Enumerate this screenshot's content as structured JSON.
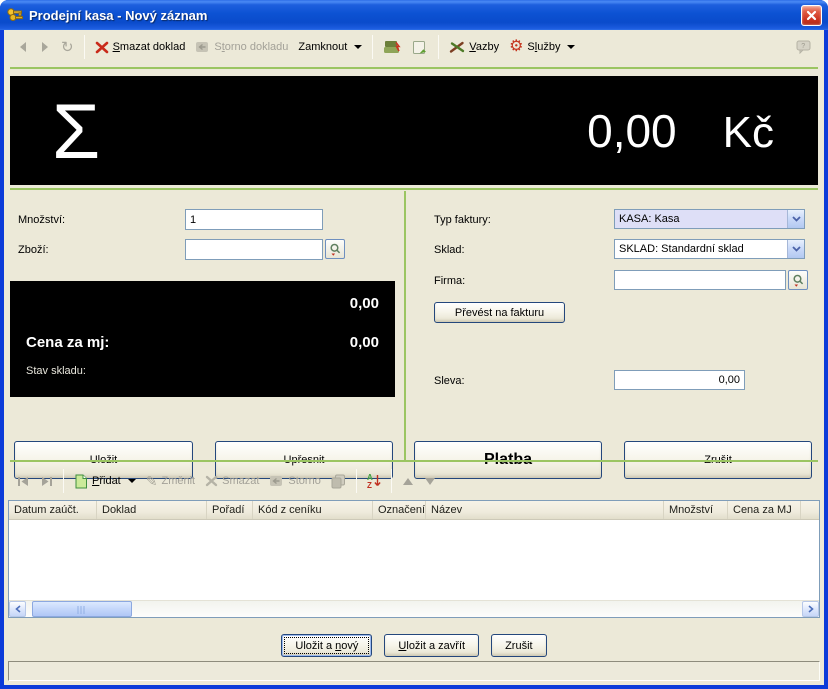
{
  "window": {
    "title": "Prodejní kasa - Nový záznam"
  },
  "toolbar": {
    "smazat_doklad": {
      "pre": "",
      "key": "S",
      "post": "mazat doklad"
    },
    "storno_dokladu": {
      "pre": "S",
      "key": "t",
      "post": "orno dokladu"
    },
    "zamknout": "Zamknout",
    "vazby": {
      "pre": "",
      "key": "V",
      "post": "azby"
    },
    "sluzby": {
      "pre": "S",
      "key": "l",
      "post": "užby"
    }
  },
  "sum_display": {
    "sigma": "Σ",
    "amount": "0,00",
    "currency": "Kč"
  },
  "item_form": {
    "mnozstvi_label": "Množství:",
    "mnozstvi_value": "1",
    "zbozi_label": "Zboží:",
    "zbozi_value": "",
    "info_total": "0,00",
    "cena_label": "Cena za mj:",
    "cena_value": "0,00",
    "stav_label": "Stav skladu:",
    "ulozit_button": "Uložit",
    "upresnit_button": "Upřesnit"
  },
  "doc_form": {
    "typ_faktury_label": "Typ faktury:",
    "typ_faktury_value": "KASA: Kasa",
    "sklad_label": "Sklad:",
    "sklad_value": "SKLAD: Standardní sklad",
    "firma_label": "Firma:",
    "firma_value": "",
    "prevest_button": "Převést na fakturu",
    "sleva_label": "Sleva:",
    "sleva_value": "0,00",
    "platba_button": "Platba",
    "zrusit_button": "Zrušit"
  },
  "grid_toolbar": {
    "pridat": {
      "pre": "",
      "key": "P",
      "post": "řidat"
    },
    "zmenit": "Změnit",
    "smazat": "Smazat",
    "storno": "Storno"
  },
  "table": {
    "columns": [
      "Datum zaúčt.",
      "Doklad",
      "Pořadí",
      "Kód z ceníku",
      "Označení",
      "Název",
      "Množství",
      "Cena za MJ"
    ],
    "rows": []
  },
  "footer": {
    "ulozit_novy": {
      "pre": "Uložit a ",
      "key": "n",
      "post": "ový"
    },
    "ulozit_zavrit": {
      "pre": "",
      "key": "U",
      "post": "ložit a zavřít"
    },
    "zrusit": "Zrušit"
  },
  "colors": {
    "title_blue": "#0C52D3",
    "frame_blue": "#0C3BD9",
    "divider_green": "#9BC562",
    "delete_red": "#C92A1A",
    "panel_black": "#000000",
    "combo_focus": "#DEDFF7"
  }
}
